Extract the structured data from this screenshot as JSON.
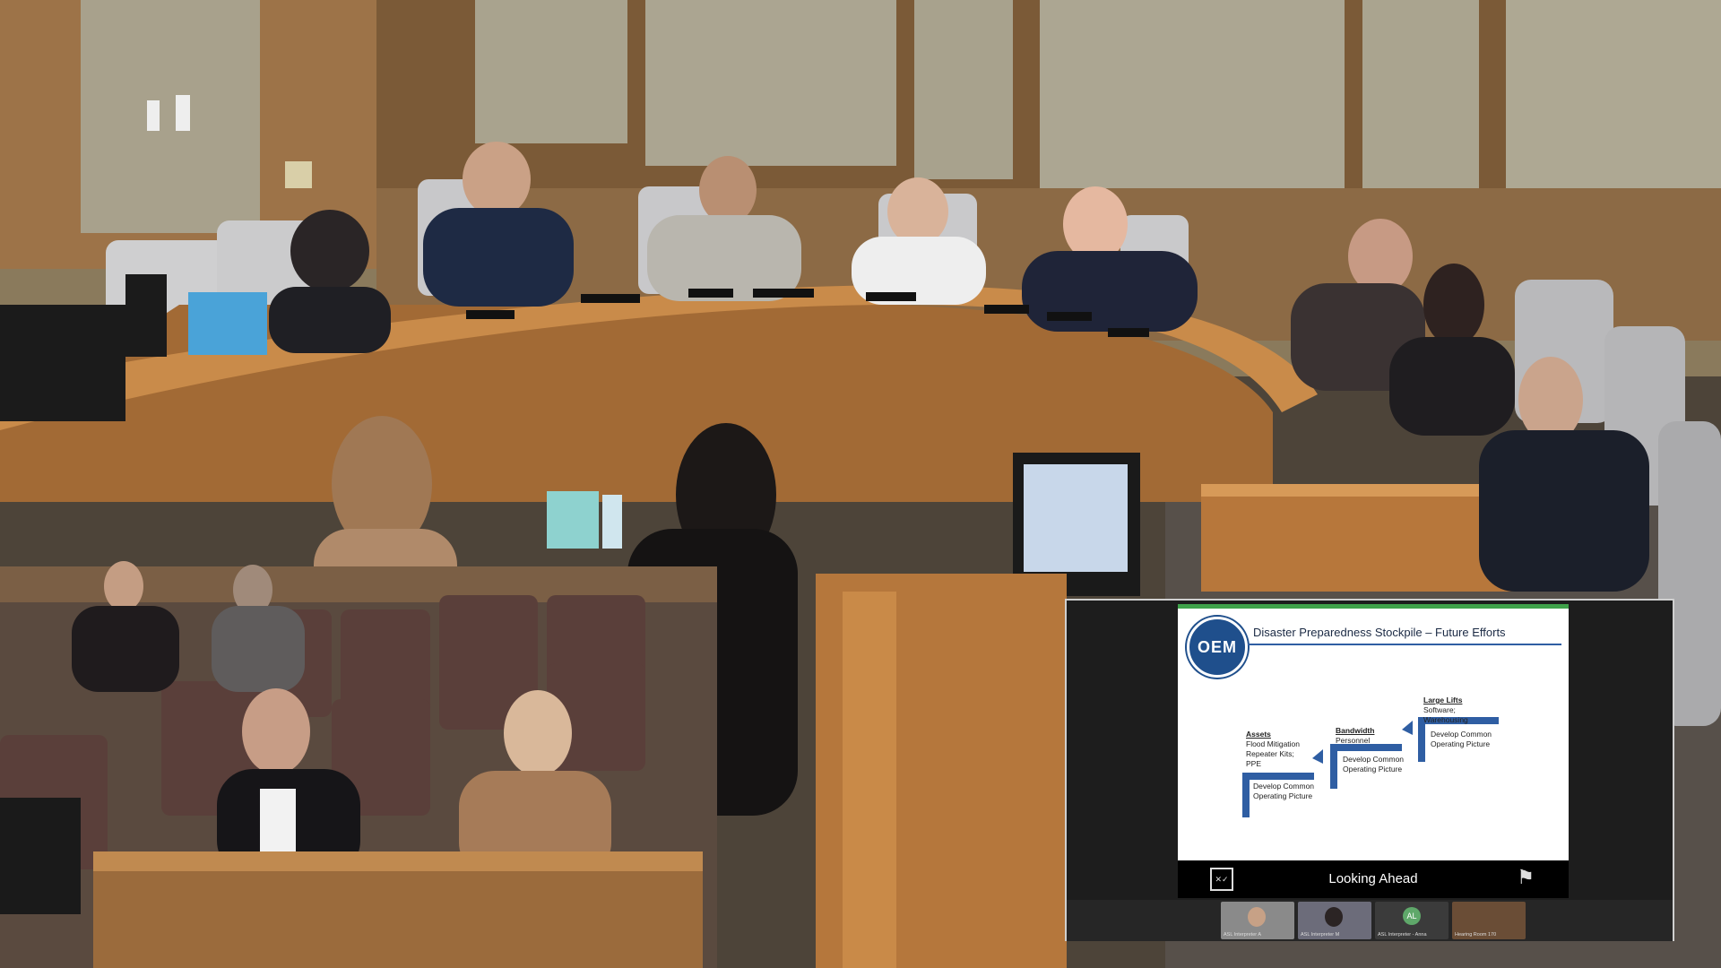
{
  "slide": {
    "logo_text": "OEM",
    "title": "Disaster Preparedness Stockpile – Future Efforts",
    "steps": [
      {
        "heading": "Assets",
        "items": "Flood Mitigation\nRepeater Kits;\nPPE",
        "action": "Develop Common\nOperating Picture"
      },
      {
        "heading": "Bandwidth",
        "items": "Personnel",
        "action": "Develop Common\nOperating Picture"
      },
      {
        "heading": "Large Lifts",
        "items": "Software;\nWarehousing",
        "action": "Develop Common\nOperating Picture"
      }
    ],
    "footer_title": "Looking Ahead"
  },
  "participants": [
    {
      "label": "ASL Interpreter A"
    },
    {
      "label": "ASL Interpreter M"
    },
    {
      "label": "ASL Interpreter - Anna",
      "initials": "AL"
    },
    {
      "label": "Hearing Room 170"
    }
  ],
  "colors": {
    "slide_accent": "#2f5ea3",
    "slide_topbar": "#3fa24a",
    "logo_blue": "#1f4f8c"
  }
}
